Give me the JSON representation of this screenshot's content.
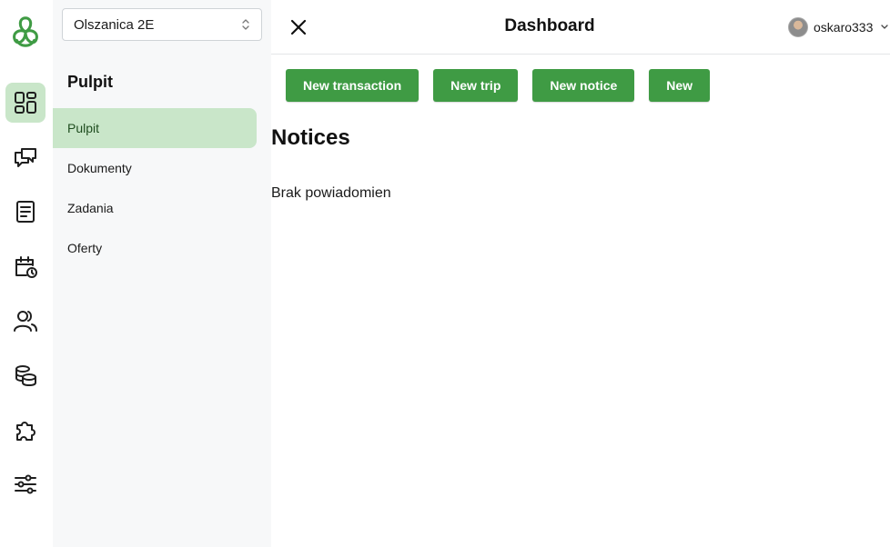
{
  "org_select": {
    "value": "Olszanica 2E"
  },
  "sidebar": {
    "section_title": "Pulpit",
    "items": [
      {
        "label": "Pulpit",
        "active": true
      },
      {
        "label": "Dokumenty",
        "active": false
      },
      {
        "label": "Zadania",
        "active": false
      },
      {
        "label": "Oferty",
        "active": false
      }
    ]
  },
  "rail": {
    "icons": [
      "dashboard-icon",
      "chat-icon",
      "document-icon",
      "calendar-clock-icon",
      "users-icon",
      "coins-icon",
      "puzzle-icon",
      "sliders-icon"
    ],
    "active": "dashboard-icon"
  },
  "header": {
    "title": "Dashboard",
    "username": "oskaro333"
  },
  "actions": {
    "new_transaction": "New transaction",
    "new_trip": "New trip",
    "new_notice": "New notice",
    "new": "New"
  },
  "notices": {
    "title": "Notices",
    "empty": "Brak powiadomien"
  },
  "colors": {
    "accent": "#3f9b44",
    "active_bg": "#c9e6c9",
    "sidebar_bg": "#f7f8f9",
    "logo": "#3f9b44"
  }
}
